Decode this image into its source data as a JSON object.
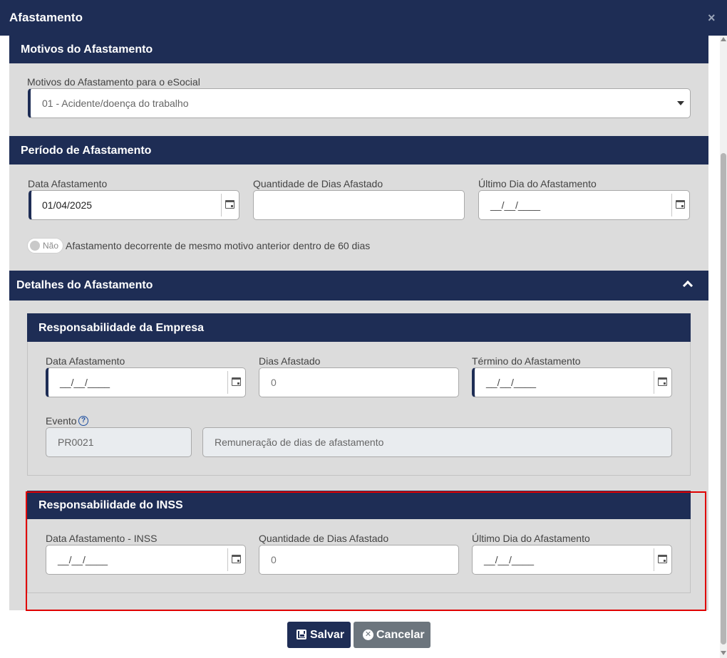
{
  "dialog": {
    "title": "Afastamento",
    "close_glyph": "×"
  },
  "motivos": {
    "header": "Motivos do Afastamento",
    "select_label": "Motivos do Afastamento para o eSocial",
    "select_value": "01 - Acidente/doença do trabalho"
  },
  "periodo": {
    "header": "Período de Afastamento",
    "data_label": "Data Afastamento",
    "data_value": "01/04/2025",
    "qtd_label": "Quantidade de Dias Afastado",
    "qtd_value": "",
    "ultimo_label": "Último Dia do Afastamento",
    "ultimo_value": "__/__/____",
    "toggle_state": "Não",
    "toggle_text": "Afastamento decorrente de mesmo motivo anterior dentro de 60 dias"
  },
  "detalhes": {
    "header": "Detalhes do Afastamento",
    "empresa": {
      "header": "Responsabilidade da Empresa",
      "data_label": "Data Afastamento",
      "data_value": "__/__/____",
      "dias_label": "Dias Afastado",
      "dias_value": "0",
      "termino_label": "Término do Afastamento",
      "termino_value": "__/__/____",
      "evento_label": "Evento",
      "evento_code": "PR0021",
      "evento_desc": "Remuneração de dias de afastamento"
    },
    "inss": {
      "header": "Responsabilidade do INSS",
      "data_label": "Data Afastamento - INSS",
      "data_value": "__/__/____",
      "qtd_label": "Quantidade de Dias Afastado",
      "qtd_value": "0",
      "ultimo_label": "Último Dia do Afastamento",
      "ultimo_value": "__/__/____"
    }
  },
  "actions": {
    "save_label": "Salvar",
    "cancel_label": "Cancelar"
  },
  "icons": {
    "calendar": "calendar-icon",
    "help": "help-icon",
    "chevron": "chevron-up-icon",
    "save": "save-icon",
    "cancel": "cancel-icon"
  },
  "colors": {
    "header_bg": "#1e2d55",
    "panel_bg": "#dcdcdc",
    "highlight": "#e00000",
    "cancel_bg": "#6c757d"
  }
}
